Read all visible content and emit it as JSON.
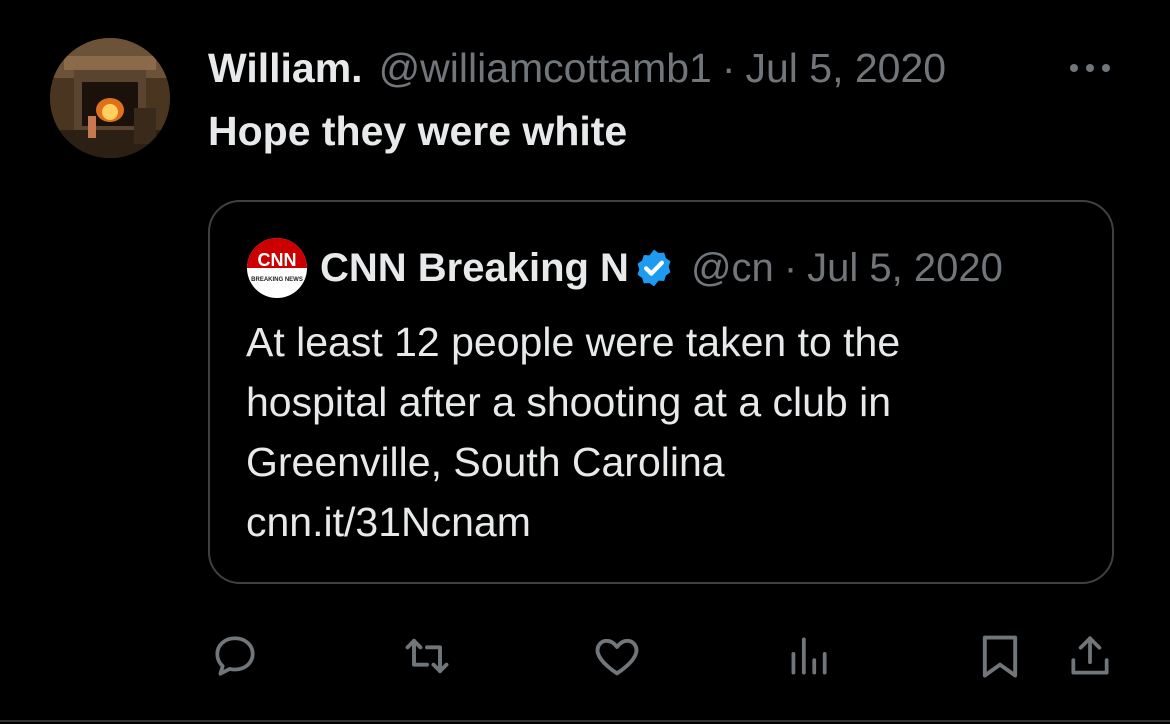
{
  "tweet": {
    "author": {
      "display_name": "William.",
      "handle": "@williamcottamb1"
    },
    "separator": "·",
    "date": "Jul 5, 2020",
    "text": "Hope they were white"
  },
  "quoted_tweet": {
    "logo": {
      "wordmark": "CNN",
      "sub": "BREAKING NEWS"
    },
    "display_name": "CNN Breaking N",
    "verified": true,
    "handle": "@cn",
    "separator": "·",
    "date": "Jul 5, 2020",
    "lines": [
      "At least 12 people were taken to the",
      "hospital after a shooting at a club in",
      "Greenville, South Carolina"
    ],
    "link": "cnn.it/31Ncnam"
  },
  "actions": [
    {
      "name": "reply",
      "icon": "reply-icon"
    },
    {
      "name": "retweet",
      "icon": "retweet-icon"
    },
    {
      "name": "like",
      "icon": "heart-icon"
    },
    {
      "name": "views",
      "icon": "analytics-icon"
    },
    {
      "name": "bookmark",
      "icon": "bookmark-icon"
    },
    {
      "name": "share",
      "icon": "share-icon"
    }
  ],
  "colors": {
    "background": "#000000",
    "text_primary": "#e7e9ea",
    "text_secondary": "#71767b",
    "border": "#3e4144",
    "verified_blue": "#1d9bf0",
    "cnn_red": "#cc0000"
  }
}
